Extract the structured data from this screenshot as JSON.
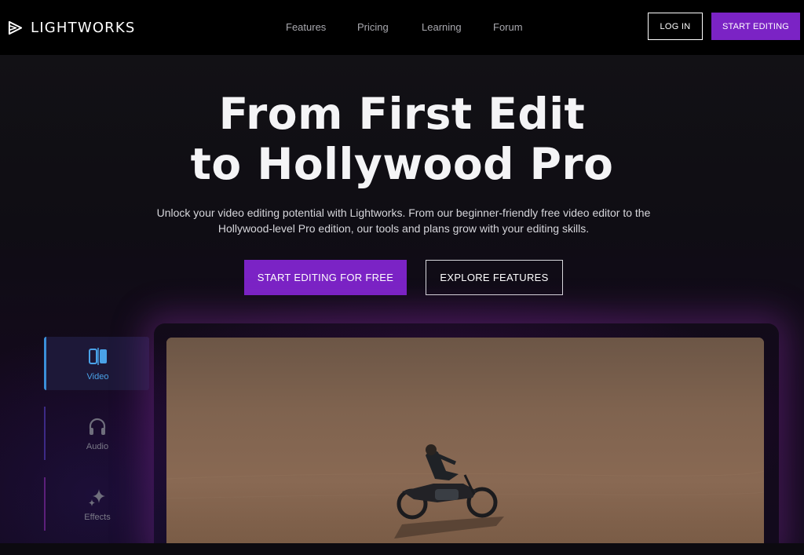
{
  "nav": {
    "logo_text": "LIGHTWORKS",
    "links": [
      "Features",
      "Pricing",
      "Learning",
      "Forum"
    ],
    "login_label": "LOG IN",
    "start_label": "START EDITING"
  },
  "hero": {
    "headline_line1": "From First Edit",
    "headline_line2": "to Hollywood Pro",
    "subtext": "Unlock your video editing potential with Lightworks. From our beginner-friendly free video editor to the Hollywood-level Pro edition, our tools and plans grow with your editing skills.",
    "primary_cta": "START EDITING FOR FREE",
    "secondary_cta": "EXPLORE FEATURES"
  },
  "tabs": [
    {
      "label": "Video",
      "icon": "video-split-icon",
      "active": true
    },
    {
      "label": "Audio",
      "icon": "headphones-icon",
      "active": false
    },
    {
      "label": "Effects",
      "icon": "sparkles-icon",
      "active": false
    }
  ],
  "colors": {
    "accent": "#7b23c5",
    "active_tab": "#4aa2e8",
    "background": "#0b0b10"
  }
}
